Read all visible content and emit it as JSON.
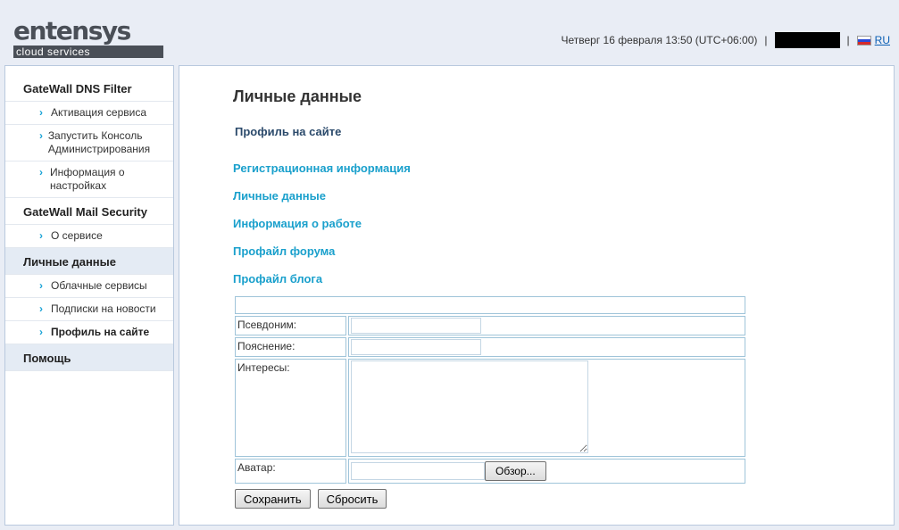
{
  "header": {
    "logo_text": "entensys",
    "logo_sub": "cloud services",
    "datetime": "Четверг 16 февраля 13:50 (UTC+06:00)",
    "lang": "RU"
  },
  "sidebar": {
    "sections": [
      {
        "title": "GateWall DNS Filter",
        "items": [
          {
            "label": "Активация сервиса"
          },
          {
            "label": "Запустить Консоль Администрирования"
          },
          {
            "label": "Информация о настройках"
          }
        ]
      },
      {
        "title": "GateWall Mail Security",
        "items": [
          {
            "label": "О сервисе"
          }
        ]
      },
      {
        "title": "Личные данные",
        "items": [
          {
            "label": "Облачные сервисы"
          },
          {
            "label": "Подписки на новости"
          },
          {
            "label": "Профиль на сайте"
          }
        ]
      },
      {
        "title": "Помощь",
        "items": []
      }
    ]
  },
  "main": {
    "title": "Личные данные",
    "subtitle": "Профиль на сайте",
    "tabs": [
      {
        "label": "Регистрационная информация"
      },
      {
        "label": "Личные данные"
      },
      {
        "label": "Информация о работе"
      },
      {
        "label": "Профайл форума"
      },
      {
        "label": "Профайл блога"
      }
    ],
    "form": {
      "pseudonym_label": "Псевдоним:",
      "pseudonym_value": "",
      "note_label": "Пояснение:",
      "note_value": "",
      "interests_label": "Интересы:",
      "interests_value": "",
      "avatar_label": "Аватар:",
      "browse_label": "Обзор..."
    },
    "actions": {
      "save_label": "Сохранить",
      "reset_label": "Сбросить"
    }
  },
  "colors": {
    "accent": "#1aa0cc",
    "border": "#b9c9de",
    "background": "#e9edf5"
  }
}
